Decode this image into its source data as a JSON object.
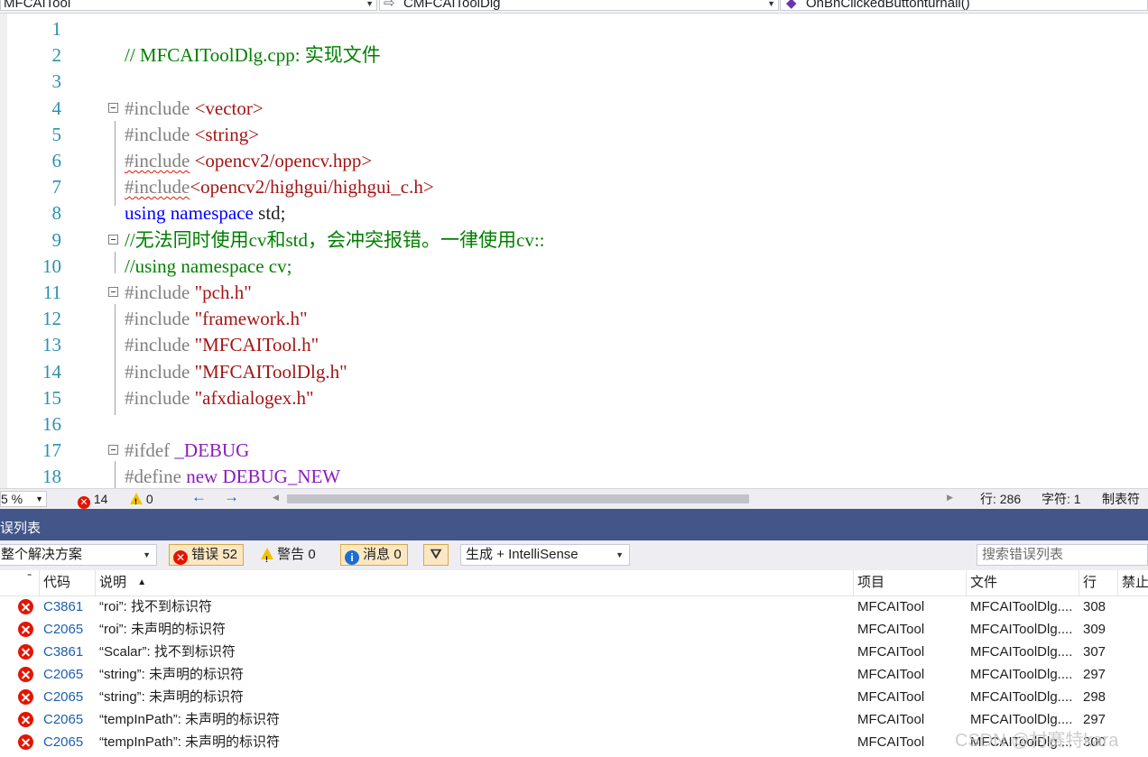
{
  "navbar": {
    "project": "MFCAITool",
    "class": "CMFCAIToolDlg",
    "member": "OnBnClickedButtonturnall()"
  },
  "editor": {
    "lines": [
      {
        "n": "1",
        "parts": []
      },
      {
        "n": "2",
        "parts": [
          {
            "t": "// MFCAIToolDlg.cpp: 实现文件",
            "c": "c-comment"
          }
        ]
      },
      {
        "n": "3",
        "parts": []
      },
      {
        "n": "4",
        "parts": [
          {
            "t": "#include ",
            "c": "c-pre"
          },
          {
            "t": "<vector>",
            "c": "c-str"
          }
        ]
      },
      {
        "n": "5",
        "parts": [
          {
            "t": "#include ",
            "c": "c-pre"
          },
          {
            "t": "<string>",
            "c": "c-str"
          }
        ]
      },
      {
        "n": "6",
        "parts": [
          {
            "t": "#include",
            "c": "c-pre squig"
          },
          {
            "t": " ",
            "c": ""
          },
          {
            "t": "<opencv2/opencv.hpp>",
            "c": "c-str"
          }
        ]
      },
      {
        "n": "7",
        "parts": [
          {
            "t": "#include",
            "c": "c-pre squig"
          },
          {
            "t": "<opencv2/highgui/highgui_c.h>",
            "c": "c-str"
          }
        ]
      },
      {
        "n": "8",
        "parts": [
          {
            "t": "using",
            "c": "c-kw"
          },
          {
            "t": " ",
            "c": ""
          },
          {
            "t": "namespace",
            "c": "c-kw"
          },
          {
            "t": " std;",
            "c": ""
          }
        ]
      },
      {
        "n": "9",
        "parts": [
          {
            "t": "//无法同时使用cv和std，会冲突报错。一律使用cv::",
            "c": "c-comment"
          }
        ]
      },
      {
        "n": "10",
        "parts": [
          {
            "t": "//using namespace cv;",
            "c": "c-comment"
          }
        ]
      },
      {
        "n": "11",
        "parts": [
          {
            "t": "#include ",
            "c": "c-pre"
          },
          {
            "t": "\"pch.h\"",
            "c": "c-str"
          }
        ]
      },
      {
        "n": "12",
        "parts": [
          {
            "t": "#include ",
            "c": "c-pre"
          },
          {
            "t": "\"framework.h\"",
            "c": "c-str"
          }
        ]
      },
      {
        "n": "13",
        "parts": [
          {
            "t": "#include ",
            "c": "c-pre"
          },
          {
            "t": "\"MFCAITool.h\"",
            "c": "c-str"
          }
        ]
      },
      {
        "n": "14",
        "parts": [
          {
            "t": "#include ",
            "c": "c-pre"
          },
          {
            "t": "\"MFCAIToolDlg.h\"",
            "c": "c-str"
          }
        ]
      },
      {
        "n": "15",
        "parts": [
          {
            "t": "#include ",
            "c": "c-pre"
          },
          {
            "t": "\"afxdialogex.h\"",
            "c": "c-str"
          }
        ]
      },
      {
        "n": "16",
        "parts": []
      },
      {
        "n": "17",
        "parts": [
          {
            "t": "#ifdef ",
            "c": "c-pre"
          },
          {
            "t": "_DEBUG",
            "c": "c-macro"
          }
        ]
      },
      {
        "n": "18",
        "parts": [
          {
            "t": "#define ",
            "c": "c-pre"
          },
          {
            "t": "new",
            "c": "c-macro"
          },
          {
            "t": " ",
            "c": ""
          },
          {
            "t": "DEBUG_NEW",
            "c": "c-macro"
          }
        ]
      }
    ]
  },
  "status": {
    "zoom": "5 %",
    "errors": "14",
    "warnings": "0",
    "line": "行: 286",
    "char": "字符: 1",
    "tab": "制表符"
  },
  "panel": {
    "title": "误列表",
    "scope": "整个解决方案",
    "errors_btn": "错误 52",
    "warnings_btn": "警告 0",
    "messages_btn": "消息 0",
    "build_filter": "生成 + IntelliSense",
    "search_placeholder": "搜索错误列表"
  },
  "table": {
    "headers": {
      "code": "代码",
      "desc": "说明",
      "project": "项目",
      "file": "文件",
      "line": "行",
      "suppress": "禁止"
    },
    "rows": [
      {
        "code": "C3861",
        "desc": "“roi”: 找不到标识符",
        "project": "MFCAITool",
        "file": "MFCAIToolDlg....",
        "line": "308"
      },
      {
        "code": "C2065",
        "desc": "“roi”: 未声明的标识符",
        "project": "MFCAITool",
        "file": "MFCAIToolDlg....",
        "line": "309"
      },
      {
        "code": "C3861",
        "desc": "“Scalar”: 找不到标识符",
        "project": "MFCAITool",
        "file": "MFCAIToolDlg....",
        "line": "307"
      },
      {
        "code": "C2065",
        "desc": "“string”: 未声明的标识符",
        "project": "MFCAITool",
        "file": "MFCAIToolDlg....",
        "line": "297"
      },
      {
        "code": "C2065",
        "desc": "“string”: 未声明的标识符",
        "project": "MFCAITool",
        "file": "MFCAIToolDlg....",
        "line": "298"
      },
      {
        "code": "C2065",
        "desc": "“tempInPath”: 未声明的标识符",
        "project": "MFCAITool",
        "file": "MFCAIToolDlg....",
        "line": "297"
      },
      {
        "code": "C2065",
        "desc": "“tempInPath”: 未声明的标识符",
        "project": "MFCAITool",
        "file": "MFCAIToolDlg....",
        "line": "300"
      }
    ]
  },
  "watermark": "CSDN @村赛特kara",
  "colors": {
    "error": "#e51400",
    "panel_title": "#42568a",
    "line_number": "#2b91af",
    "comment": "#008000",
    "string": "#a31515",
    "keyword": "#0000ff"
  }
}
